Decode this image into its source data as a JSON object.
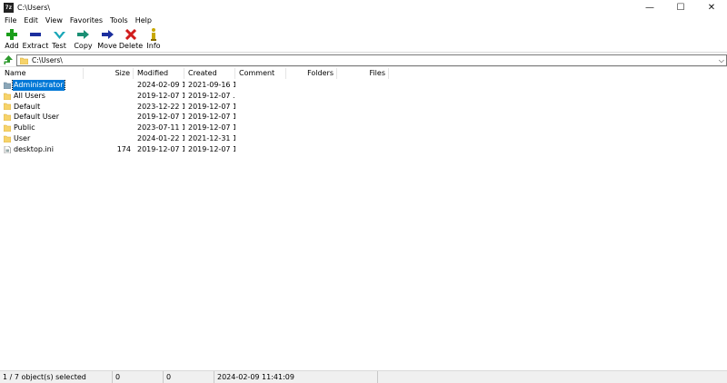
{
  "window": {
    "icon_text": "7z",
    "title": "C:\\Users\\",
    "minimize": "—",
    "maximize": "☐",
    "close": "✕"
  },
  "menu": [
    "File",
    "Edit",
    "View",
    "Favorites",
    "Tools",
    "Help"
  ],
  "toolbar": [
    {
      "label": "Add",
      "icon": "plus-icon",
      "color": "#1a9e1a"
    },
    {
      "label": "Extract",
      "icon": "minus-icon",
      "color": "#1c2f9e"
    },
    {
      "label": "Test",
      "icon": "test-check-icon",
      "color": "#1aa7b8"
    },
    {
      "label": "Copy",
      "icon": "copy-arrow-icon",
      "color": "#1a8f74"
    },
    {
      "label": "Move",
      "icon": "move-arrow-icon",
      "color": "#1c2f9e"
    },
    {
      "label": "Delete",
      "icon": "delete-x-icon",
      "color": "#d11c1c"
    },
    {
      "label": "Info",
      "icon": "info-icon",
      "color": "#c8a800"
    }
  ],
  "address": {
    "path": "C:\\Users\\"
  },
  "columns": [
    "Name",
    "Size",
    "Modified",
    "Created",
    "Comment",
    "Folders",
    "Files"
  ],
  "rows": [
    {
      "name": "Administrator",
      "type": "folder-gray",
      "size": "",
      "modified": "2024-02-09 1...",
      "created": "2021-09-16 1...",
      "selected": true
    },
    {
      "name": "All Users",
      "type": "folder",
      "size": "",
      "modified": "2019-12-07 1...",
      "created": "2019-12-07 ...",
      "selected": false
    },
    {
      "name": "Default",
      "type": "folder",
      "size": "",
      "modified": "2023-12-22 1...",
      "created": "2019-12-07 1...",
      "selected": false
    },
    {
      "name": "Default User",
      "type": "folder",
      "size": "",
      "modified": "2019-12-07 1...",
      "created": "2019-12-07 1...",
      "selected": false
    },
    {
      "name": "Public",
      "type": "folder",
      "size": "",
      "modified": "2023-07-11 1...",
      "created": "2019-12-07 1...",
      "selected": false
    },
    {
      "name": "User",
      "type": "folder",
      "size": "",
      "modified": "2024-01-22 1...",
      "created": "2021-12-31 1...",
      "selected": false
    },
    {
      "name": "desktop.ini",
      "type": "file",
      "size": "174",
      "modified": "2019-12-07 1...",
      "created": "2019-12-07 1...",
      "selected": false
    }
  ],
  "status": {
    "selection": "1 / 7 object(s) selected",
    "size": "0",
    "packed": "0",
    "datetime": "2024-02-09 11:41:09"
  },
  "colors": {
    "selection": "#0078d7",
    "folder": "#f6d36b",
    "folder_gray": "#8ba6b8"
  }
}
